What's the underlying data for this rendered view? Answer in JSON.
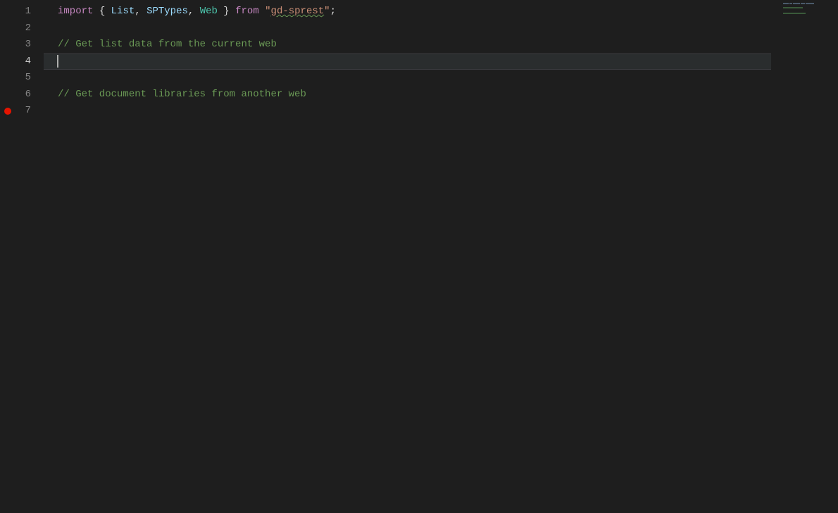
{
  "editor": {
    "lines": [
      {
        "num": "1",
        "type": "code"
      },
      {
        "num": "2",
        "type": "empty"
      },
      {
        "num": "3",
        "type": "comment"
      },
      {
        "num": "4",
        "type": "active"
      },
      {
        "num": "5",
        "type": "empty"
      },
      {
        "num": "6",
        "type": "comment"
      },
      {
        "num": "7",
        "type": "breakpoint"
      }
    ],
    "line1": {
      "import": "import",
      "brace_open": " { ",
      "id1": "List",
      "comma1": ", ",
      "id2": "SPTypes",
      "comma2": ", ",
      "id3": "Web",
      "brace_close": " } ",
      "from": "from",
      "space": " ",
      "quote_open": "\"",
      "module": "gd-sprest",
      "quote_close": "\"",
      "semi": ";"
    },
    "line3_comment": "// Get list data from the current web",
    "line6_comment": "// Get document libraries from another web",
    "active_line": 4,
    "breakpoint_line": 7
  }
}
